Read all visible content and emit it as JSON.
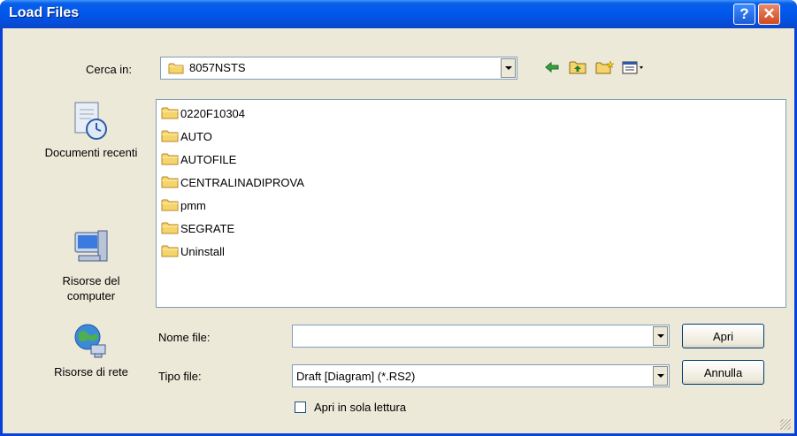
{
  "window": {
    "title": "Load Files"
  },
  "titlebar": {
    "help_glyph": "?",
    "close_glyph": "✕"
  },
  "lookin": {
    "label": "Cerca in:",
    "value": "8057NSTS"
  },
  "toolbar": {
    "icons": [
      "back-arrow-icon",
      "up-one-level-icon",
      "new-folder-icon",
      "view-menu-icon"
    ]
  },
  "places": [
    {
      "label": "Documenti recenti",
      "icon": "recent-documents-icon"
    },
    {
      "label": "Risorse del computer",
      "icon": "my-computer-icon"
    },
    {
      "label": "Risorse di rete",
      "icon": "network-places-icon"
    }
  ],
  "files": [
    {
      "name": "0220F10304"
    },
    {
      "name": "AUTO"
    },
    {
      "name": "AUTOFILE"
    },
    {
      "name": "CENTRALINADIPROVA"
    },
    {
      "name": "pmm"
    },
    {
      "name": "SEGRATE"
    },
    {
      "name": "Uninstall"
    }
  ],
  "filename": {
    "label": "Nome file:",
    "value": ""
  },
  "filetype": {
    "label": "Tipo file:",
    "value": "Draft [Diagram]  (*.RS2)"
  },
  "buttons": {
    "open": "Apri",
    "cancel": "Annulla"
  },
  "readonly": {
    "label": "Apri in sola lettura",
    "checked": false
  },
  "colors": {
    "titlebar": "#0058ee",
    "dialog_bg": "#ece9d8",
    "folder": "#f5d46b"
  }
}
